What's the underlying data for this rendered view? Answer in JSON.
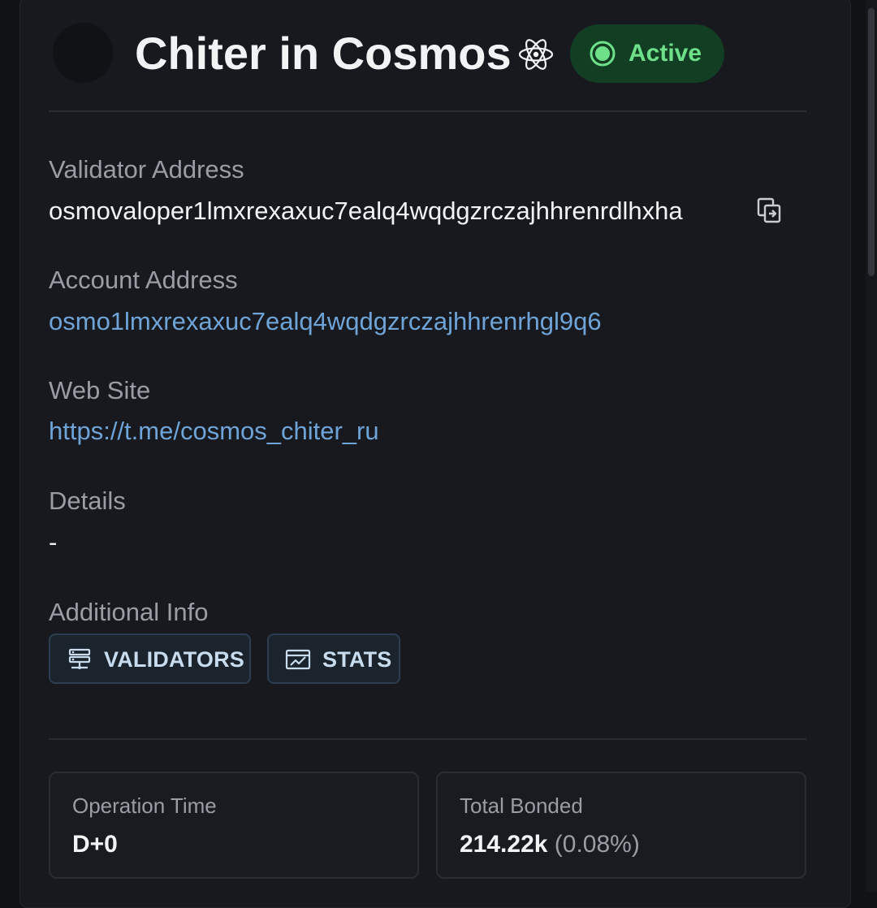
{
  "header": {
    "validator_name": "Chiter in Cosmos",
    "badge_icon": "atom-icon",
    "status_label": "Active",
    "status_color": "#6ee08a"
  },
  "fields": {
    "validator_address": {
      "label": "Validator Address",
      "value": "osmovaloper1lmxrexaxuc7ealq4wqdgzrczajhhrenrdlhxha"
    },
    "account_address": {
      "label": "Account Address",
      "value": "osmo1lmxrexaxuc7ealq4wqdgzrczajhhrenrhgl9q6"
    },
    "web_site": {
      "label": "Web Site",
      "value": "https://t.me/cosmos_chiter_ru"
    },
    "details": {
      "label": "Details",
      "value": "-"
    },
    "additional_info": {
      "label": "Additional Info",
      "buttons": [
        {
          "label": "VALIDATORS",
          "icon": "server-icon"
        },
        {
          "label": "STATS",
          "icon": "chart-icon"
        }
      ]
    }
  },
  "stats": {
    "operation_time": {
      "label": "Operation Time",
      "value": "D+0"
    },
    "total_bonded": {
      "label": "Total Bonded",
      "value": "214.22k",
      "share": "(0.08%)"
    }
  },
  "colors": {
    "background": "#18191e",
    "link": "#6ea4d8",
    "accent_green": "#6ee08a",
    "chip_text": "#c8dcee"
  }
}
